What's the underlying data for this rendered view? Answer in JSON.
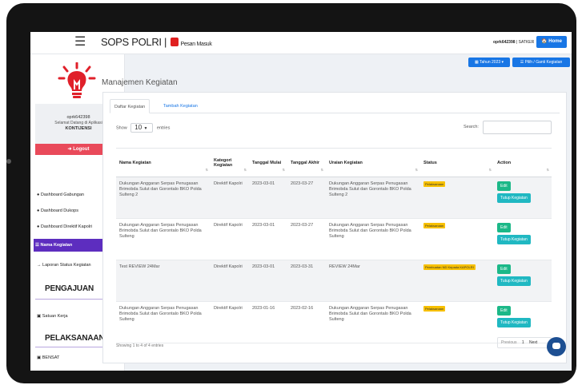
{
  "header": {
    "title": "SOPS POLRI |",
    "mail_label": "Pesan Masuk",
    "user": "oprk642398",
    "role": "SATKER",
    "home_label": "Home"
  },
  "sidebar": {
    "username": "oprk642398",
    "greeting": "Selamat Datang di Aplikasi",
    "app_name": "KONTIJENSI",
    "logout_label": "Logout",
    "items": [
      {
        "label": "Dashboard Gabungan"
      },
      {
        "label": "Dashboard Dukops"
      },
      {
        "label": "Dashboard Direktif Kapolri"
      },
      {
        "label": "Nama Kegiatan"
      },
      {
        "label": "Laporan Status Kegiatan"
      }
    ],
    "section_pengajuan": "PENGAJUAN",
    "satuan_kerja": "Satuan Kerja",
    "section_pelaksanaan": "PELAKSANAAN",
    "bensat": "BENSAT"
  },
  "controls": {
    "year_label": "Tahun 2023",
    "pick_label": "Pilih / Ganti Kegiatan"
  },
  "page": {
    "title": "Manajemen Kegiatan",
    "tab_list": "Daftar Kegiatan",
    "tab_add": "Tambah Kegiatan",
    "show_label": "Show",
    "show_value": "10",
    "entries_label": "entries",
    "search_label": "Search:",
    "showing_text": "Showing 1 to 4 of 4 entries",
    "pager_prev": "Previous",
    "pager_page": "1",
    "pager_next": "Next"
  },
  "table": {
    "headers": [
      "Nama Kegiatan",
      "Kategori Kegiatan",
      "Tanggal Mulai",
      "Tanggal Akhir",
      "Uraian Kegiatan",
      "Status",
      "Action"
    ],
    "edit_label": "Edit",
    "close_label": "Tutup Kegiatan",
    "rows": [
      {
        "nama": "Dukungan Anggaran Serpas Penugasan Brimobda Sulut dan Gorontalo BKO Polda Sulteng 2",
        "kategori": "Direktif Kapolri",
        "mulai": "2023-03-01",
        "akhir": "2023-03-27",
        "uraian": "Dukungan Anggaran Serpas Penugasan Brimobda Sulut dan Gorontalo BKO Polda Sulteng 2",
        "status": "Pelaksanaan"
      },
      {
        "nama": "Dukungan Anggaran Serpas Penugasan Brimobda Sulut dan Gorontalo BKO Polda Sulteng",
        "kategori": "Direktif Kapolri",
        "mulai": "2023-03-01",
        "akhir": "2023-03-27",
        "uraian": "Dukungan Anggaran Serpas Penugasan Brimobda Sulut dan Gorontalo BKO Polda Sulteng",
        "status": "Pelaksanaan"
      },
      {
        "nama": "Test REVIEW 24Mar",
        "kategori": "Direktif Kapolri",
        "mulai": "2023-03-01",
        "akhir": "2023-03-31",
        "uraian": "REVIEW 24Mar",
        "status": "Pembuatan ND Kepada KAPOLRI"
      },
      {
        "nama": "Dukungan Anggaran Serpas Penugasan Brimobda Sulut dan Gorontalo BKO Polda Sulteng",
        "kategori": "Direktif Kapolri",
        "mulai": "2023-01-16",
        "akhir": "2023-02-16",
        "uraian": "Dukungan Anggaran Serpas Penugasan Brimobda Sulut dan Gorontalo BKO Polda Sulteng",
        "status": "Pelaksanaan"
      }
    ]
  },
  "colors": {
    "accent": "#1876e5",
    "active_nav": "#5d2dbf",
    "logout": "#e94a5a",
    "status": "#f7c000",
    "edit": "#1cb888",
    "close": "#20b8c2"
  }
}
